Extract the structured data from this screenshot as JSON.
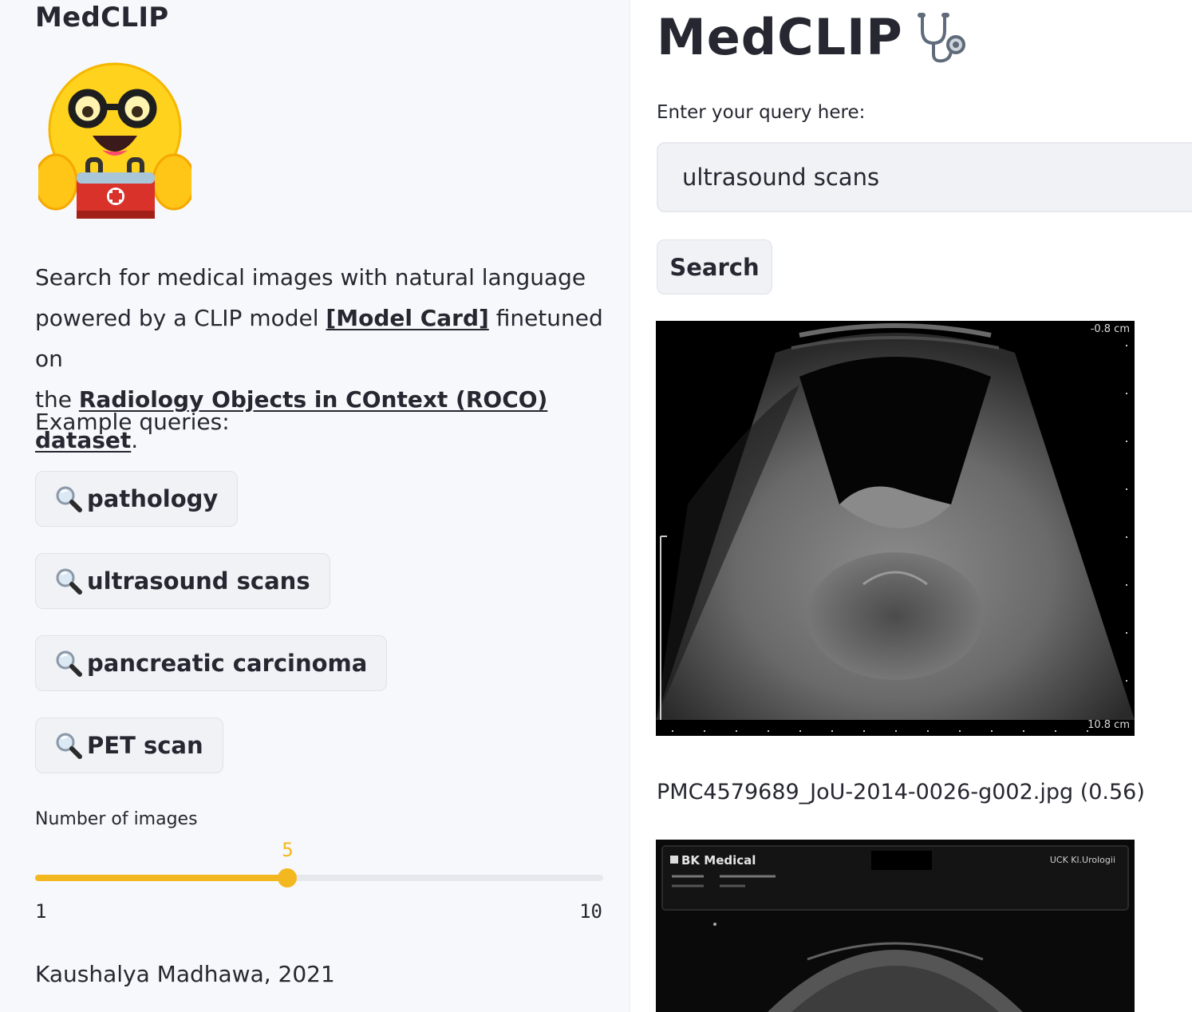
{
  "sidebar": {
    "title": "MedCLIP",
    "logo_icon": "hugging-face-doctor-emoji-icon",
    "description": {
      "line1": "Search for medical images with natural language",
      "line2_pre": "powered by a CLIP model ",
      "model_card_link": "[Model Card]",
      "line2_post": " finetuned on",
      "line3_pre": "the ",
      "dataset_link": "Radiology Objects in COntext (ROCO) dataset",
      "line3_post": "."
    },
    "examples_label": "Example queries:",
    "example_queries": [
      {
        "label": "pathology",
        "icon": "magnifier-icon"
      },
      {
        "label": "ultrasound scans",
        "icon": "magnifier-icon"
      },
      {
        "label": "pancreatic carcinoma",
        "icon": "magnifier-icon"
      },
      {
        "label": "PET scan",
        "icon": "magnifier-icon"
      }
    ],
    "slider": {
      "label": "Number of images",
      "value": 5,
      "value_label": "5",
      "min": 1,
      "max": 10,
      "min_label": "1",
      "max_label": "10",
      "accent_color": "#f3b81f"
    },
    "footer": "Kaushalya Madhawa, 2021"
  },
  "main": {
    "title": "MedCLIP",
    "title_icon": "stethoscope-icon",
    "query_label": "Enter your query here:",
    "query_value": "ultrasound scans",
    "search_label": "Search",
    "results": [
      {
        "image_labels": {
          "top_right": "-0.8 cm",
          "bottom_right": "10.8 cm"
        },
        "caption": "PMC4579689_JoU-2014-0026-g002.jpg (0.56)"
      },
      {
        "image_labels": {
          "brand": "BK Medical",
          "top_right": "UCK Kl.Urologii"
        },
        "caption": ""
      }
    ]
  }
}
